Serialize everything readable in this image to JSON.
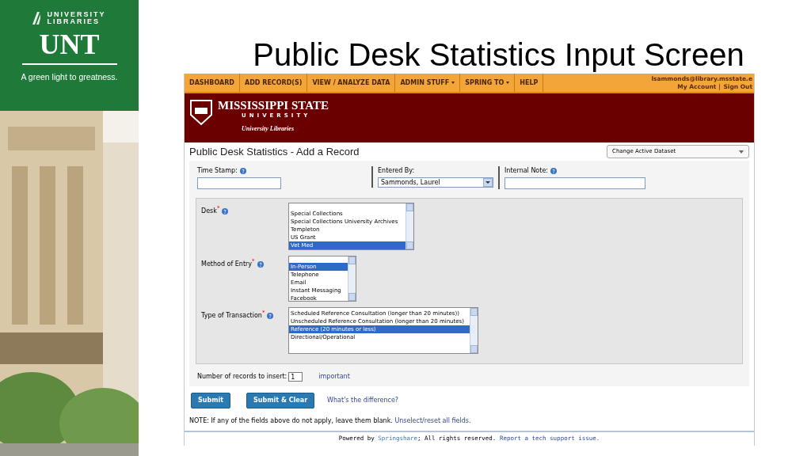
{
  "slide": {
    "title": "Public Desk Statistics Input Screen",
    "logo": {
      "line_1": "UNIVERSITY",
      "line_2": "LIBRARIES",
      "wordmark": "UNT",
      "tagline": "A green light to greatness."
    }
  },
  "nav": {
    "items": [
      {
        "label": "DASHBOARD",
        "dropdown": false
      },
      {
        "label": "ADD RECORD(S)",
        "dropdown": false
      },
      {
        "label": "VIEW / ANALYZE DATA",
        "dropdown": false
      },
      {
        "label": "ADMIN STUFF",
        "dropdown": true
      },
      {
        "label": "SPRING TO",
        "dropdown": true
      },
      {
        "label": "HELP",
        "dropdown": false
      }
    ],
    "user_email": "lsammonds@library.msstate.e",
    "links": [
      "My Account",
      "Sign Out"
    ]
  },
  "banner": {
    "name": "MISSISSIPPI STATE",
    "subtitle": "UNIVERSITY",
    "unit": "University Libraries"
  },
  "page_title": "Public Desk Statistics - Add a Record",
  "dataset_select": {
    "value": "Change Active Dataset"
  },
  "top_fields": [
    {
      "label": "Time Stamp:",
      "help": true,
      "kind": "text"
    },
    {
      "label": "Entered By:",
      "help": false,
      "kind": "select",
      "value": "Sammonds, Laurel"
    },
    {
      "label": "Internal Note:",
      "help": true,
      "kind": "text"
    }
  ],
  "lists": [
    {
      "label": "Desk",
      "required_mark": "*",
      "help": true,
      "options": [
        {
          "label": "Special Collections",
          "selected": false
        },
        {
          "label": "Special Collections University Archives",
          "selected": false
        },
        {
          "label": "Templeton",
          "selected": false
        },
        {
          "label": "US Grant",
          "selected": false
        },
        {
          "label": "Vet Med",
          "selected": true
        }
      ]
    },
    {
      "label": "Method of Entry",
      "required_mark": "*",
      "help": true,
      "options": [
        {
          "label": "In-Person",
          "selected": true
        },
        {
          "label": "Telephone",
          "selected": false
        },
        {
          "label": "Email",
          "selected": false
        },
        {
          "label": "Instant Messaging",
          "selected": false
        },
        {
          "label": "Facebook",
          "selected": false
        }
      ]
    },
    {
      "label": "Type of Transaction",
      "required_mark": "*",
      "help": true,
      "options": [
        {
          "label": "Scheduled Reference Consultation (longer than 20 minutes))",
          "selected": false
        },
        {
          "label": "Unscheduled Reference Consultation (longer than 20 minutes)",
          "selected": false
        },
        {
          "label": "Reference (20 minutes or less)",
          "selected": true
        },
        {
          "label": "Directional/Operational",
          "selected": false
        }
      ]
    }
  ],
  "records": {
    "label": "Number of records to insert:",
    "value": "1",
    "link": "important"
  },
  "buttons": [
    "Submit",
    "Submit & Clear"
  ],
  "difference_link": "What's the difference?",
  "note": {
    "text": "NOTE: If any of the fields above do not apply, leave them blank.",
    "link": "Unselect/reset all fields."
  },
  "footer": {
    "prefix": "Powered by",
    "brand": "Springshare",
    "middle": "; All rights reserved.",
    "link": "Report a tech support issue."
  }
}
